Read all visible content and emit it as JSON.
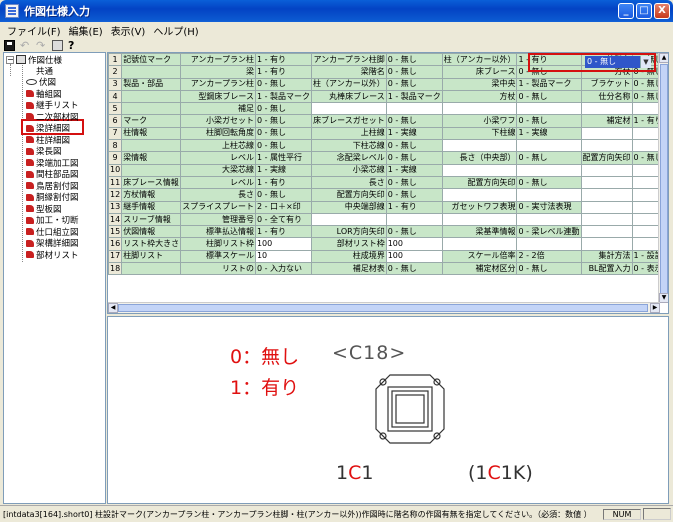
{
  "window": {
    "title": "作図仕様入力",
    "minimize": "_",
    "maximize": "□",
    "close": "X"
  },
  "menu": {
    "items": [
      "ファイル(F)",
      "編集(E)",
      "表示(V)",
      "ヘルプ(H)"
    ]
  },
  "toolbar": {
    "icons": [
      "save-icon",
      "undo-icon",
      "redo-icon",
      "print-icon",
      "help-icon"
    ]
  },
  "tree": {
    "root": "作図仕様",
    "items": [
      "共通",
      "伏図",
      "軸組図",
      "継手リスト",
      "二次部材図",
      "梁詳細図",
      "柱詳細図",
      "梁長図",
      "梁端加工図",
      "間柱部品図",
      "鳥居割付図",
      "胴縁割付図",
      "型板図",
      "加工・切断",
      "仕口組立図",
      "架構詳細図",
      "部材リスト"
    ]
  },
  "grid": {
    "rows": [
      {
        "n": "1",
        "cat": "記號位マーク",
        "cells": [
          [
            "アンカープラン柱",
            "1 - 有り"
          ],
          [
            "アンカープラン柱脚",
            "0 - 無し"
          ],
          [
            "柱（アンカー以外）",
            "1 - 有り"
          ],
          [
            "柱階名",
            "0 - 無し"
          ]
        ]
      },
      {
        "n": "2",
        "cat": "",
        "cells": [
          [
            "梁",
            "1 - 有り"
          ],
          [
            "梁階名",
            "0 - 無し"
          ],
          [
            "床ブレース",
            "0 - 無し"
          ],
          [
            "方杖",
            "0 - 無し"
          ]
        ]
      },
      {
        "n": "3",
        "cat": "製品・部品",
        "cells": [
          [
            "アンカープラン柱",
            "0 - 無し"
          ],
          [
            "柱（アンカー以外）",
            "0 - 無し"
          ],
          [
            "梁中央",
            "1 - 製品マーク"
          ],
          [
            "ブラケット",
            "0 - 無し"
          ]
        ]
      },
      {
        "n": "4",
        "cat": "",
        "cells": [
          [
            "型鋼床ブレース",
            "1 - 製品マーク"
          ],
          [
            "丸棒床ブレース",
            "1 - 製品マーク"
          ],
          [
            "方杖",
            "0 - 無し"
          ],
          [
            "仕分名称",
            "0 - 無し"
          ]
        ]
      },
      {
        "n": "5",
        "cat": "",
        "cells": [
          [
            "補足",
            "0 - 無し"
          ],
          [
            "",
            ""
          ],
          [
            "",
            ""
          ],
          [
            "",
            ""
          ]
        ]
      },
      {
        "n": "6",
        "cat": "マーク",
        "cells": [
          [
            "小梁ガセット",
            "0 - 無し"
          ],
          [
            "床ブレースガセット",
            "0 - 無し"
          ],
          [
            "小梁ワフ",
            "0 - 無し"
          ],
          [
            "補定材",
            "1 - 有り"
          ]
        ]
      },
      {
        "n": "7",
        "cat": "柱情報",
        "cells": [
          [
            "柱脚回転角度",
            "0 - 無し"
          ],
          [
            "上柱線",
            "1 - 実線"
          ],
          [
            "下柱線",
            "1 - 実線"
          ],
          [
            "",
            ""
          ]
        ]
      },
      {
        "n": "8",
        "cat": "",
        "cells": [
          [
            "上柱芯線",
            "0 - 無し"
          ],
          [
            "下柱芯線",
            "0 - 無し"
          ],
          [
            "",
            ""
          ],
          [
            "",
            ""
          ]
        ]
      },
      {
        "n": "9",
        "cat": "梁情報",
        "cells": [
          [
            "レベル",
            "1 - 属性平行"
          ],
          [
            "念配梁レベル",
            "0 - 無し"
          ],
          [
            "長さ（中央部）",
            "0 - 無し"
          ],
          [
            "配置方向矢印",
            "0 - 無し"
          ]
        ]
      },
      {
        "n": "10",
        "cat": "",
        "cells": [
          [
            "大梁芯線",
            "1 - 実線"
          ],
          [
            "小梁芯線",
            "1 - 実線"
          ],
          [
            "",
            ""
          ],
          [
            "",
            ""
          ]
        ]
      },
      {
        "n": "11",
        "cat": "床ブレース情報",
        "cells": [
          [
            "レベル",
            "1 - 有り"
          ],
          [
            "長さ",
            "0 - 無し"
          ],
          [
            "配置方向矢印",
            "0 - 無し"
          ],
          [
            "",
            ""
          ]
        ]
      },
      {
        "n": "12",
        "cat": "方杖情報",
        "cells": [
          [
            "長さ",
            "0 - 無し"
          ],
          [
            "配置方向矢印",
            "0 - 無し"
          ],
          [
            "",
            ""
          ],
          [
            "",
            ""
          ]
        ]
      },
      {
        "n": "13",
        "cat": "継手情報",
        "cells": [
          [
            "スプライスプレート",
            "2 - 口＋×印"
          ],
          [
            "中央端部線",
            "1 - 有り"
          ],
          [
            "ガセットワフ表現",
            "0 - 実寸法表現"
          ],
          [
            "",
            ""
          ]
        ]
      },
      {
        "n": "14",
        "cat": "スリーブ情報",
        "cells": [
          [
            "管理番号",
            "0 - 全て有り"
          ],
          [
            "",
            ""
          ],
          [
            "",
            ""
          ],
          [
            "",
            ""
          ]
        ]
      },
      {
        "n": "15",
        "cat": "伏図情報",
        "cells": [
          [
            "標準払込情報",
            "1 - 有り"
          ],
          [
            "LOR方向矢印",
            "0 - 無し"
          ],
          [
            "梁基準情報",
            "0 - 梁レベル連動"
          ],
          [
            "",
            ""
          ]
        ]
      },
      {
        "n": "16",
        "cat": "リスト枠大きさ",
        "cells": [
          [
            "柱脚リスト枠",
            "100"
          ],
          [
            "部材リスト枠",
            "100"
          ],
          [
            "",
            ""
          ],
          [
            "",
            ""
          ]
        ]
      },
      {
        "n": "17",
        "cat": "柱脚リスト",
        "cells": [
          [
            "標準スケール",
            "10"
          ],
          [
            "柱成境界",
            "100"
          ],
          [
            "スケール倍率",
            "2 - 2倍"
          ],
          [
            "集計方法",
            "1 - 設計マーク毎"
          ]
        ]
      },
      {
        "n": "18",
        "cat": "",
        "cells": [
          [
            "リストの",
            "0 - 入力ない"
          ],
          [
            "補足材表",
            "0 - 無し"
          ],
          [
            "補定材区分",
            "0 - 無し"
          ],
          [
            "BL配置入力",
            "0 - 表示"
          ]
        ]
      }
    ],
    "highlighted": {
      "label": "柱階名",
      "value": "0 - 無し"
    }
  },
  "preview": {
    "legend": [
      "0：無し",
      "1：有り"
    ],
    "mark": "<C18>",
    "label_left_prefix": "1",
    "label_left_highlight": "C",
    "label_left_suffix": "1",
    "label_right_prefix": "(1",
    "label_right_highlight": "C",
    "label_right_suffix": "1K)"
  },
  "status": {
    "message": "[intdata3[164].short0] 柱設計マーク(アンカープラン柱・アンカープラン柱脚・柱(アンカー以外))作図時に階名称の作図有無を指定してください。（必須：数値 ）",
    "num": "NUM"
  },
  "colors": {
    "cell_green": "#c8e6c8",
    "accent_red": "#e01010",
    "select_blue": "#2f56c9"
  }
}
